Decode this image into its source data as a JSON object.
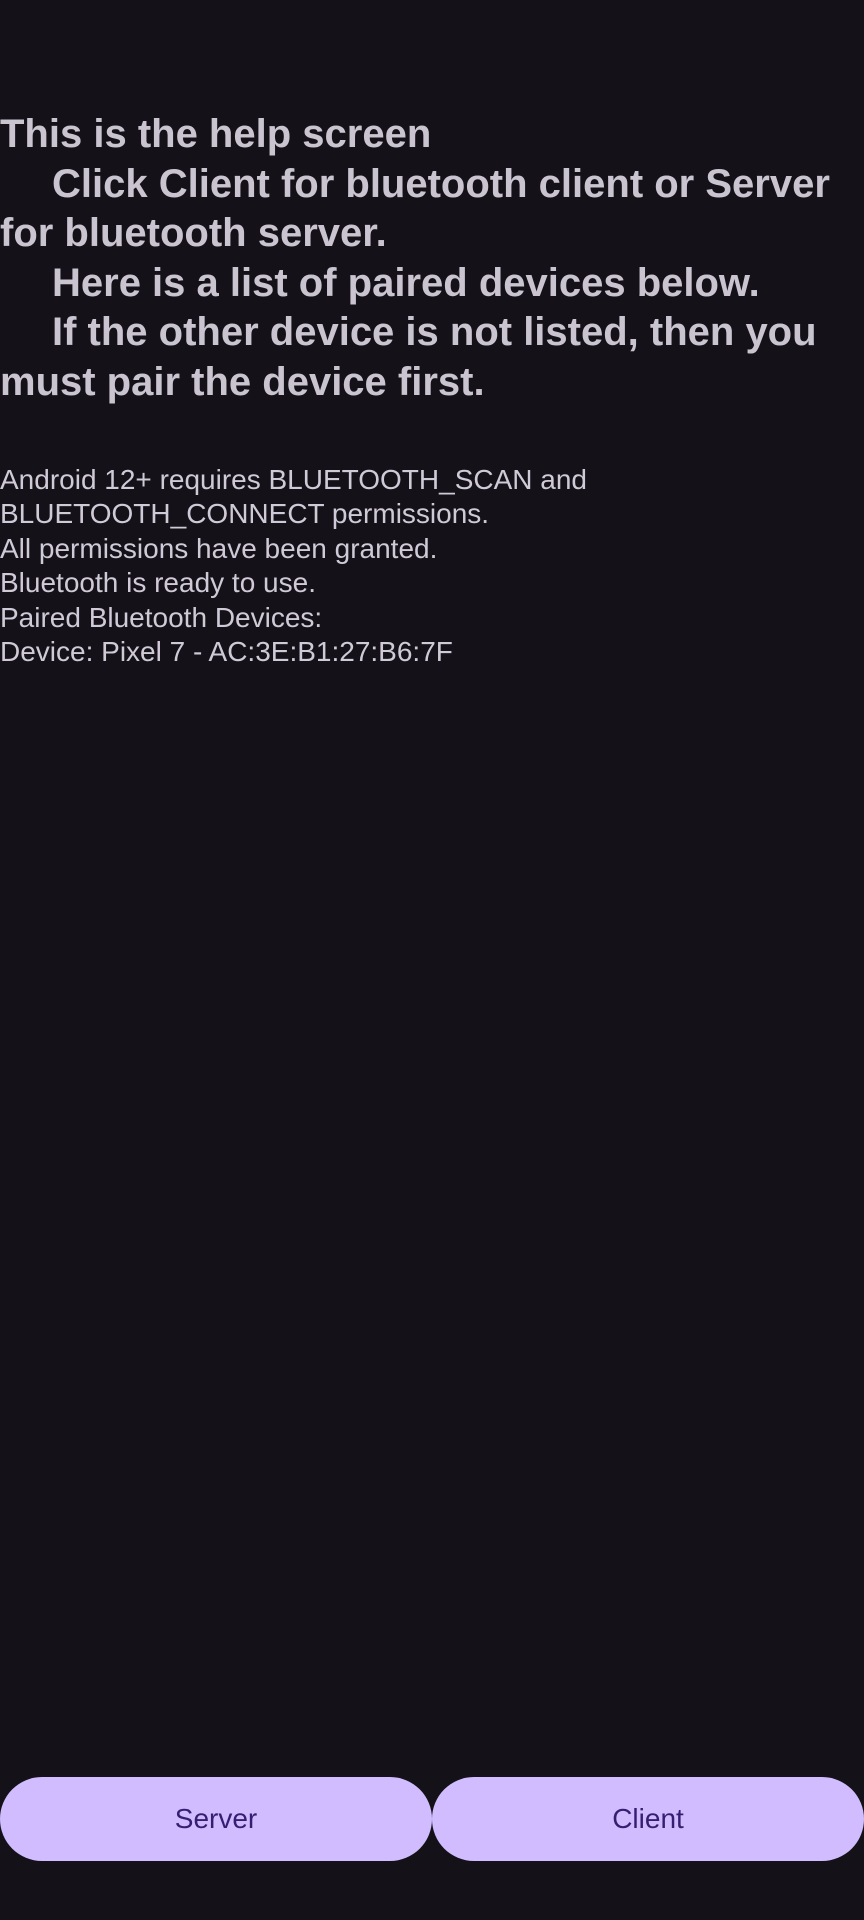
{
  "help": {
    "lines": [
      {
        "indent": false,
        "text": "This is the help screen"
      },
      {
        "indent": true,
        "text": "Click Client for bluetooth client or Server"
      },
      {
        "indent": false,
        "text": "for bluetooth server."
      },
      {
        "indent": true,
        "text": "Here is a list of paired devices below."
      },
      {
        "indent": true,
        "text": "If the other device is not listed, then you"
      },
      {
        "indent": false,
        "text": "must pair the device first."
      }
    ]
  },
  "status": {
    "lines": [
      "Android 12+ requires BLUETOOTH_SCAN and",
      "BLUETOOTH_CONNECT permissions.",
      "All permissions have been granted.",
      "Bluetooth is ready to use.",
      "Paired Bluetooth Devices:",
      "Device: Pixel 7 - AC:3E:B1:27:B6:7F"
    ]
  },
  "buttons": {
    "server_label": "Server",
    "client_label": "Client"
  },
  "colors": {
    "background": "#141218",
    "text": "#cac4d0",
    "button_bg": "#d0bcff",
    "button_text": "#381e72"
  }
}
